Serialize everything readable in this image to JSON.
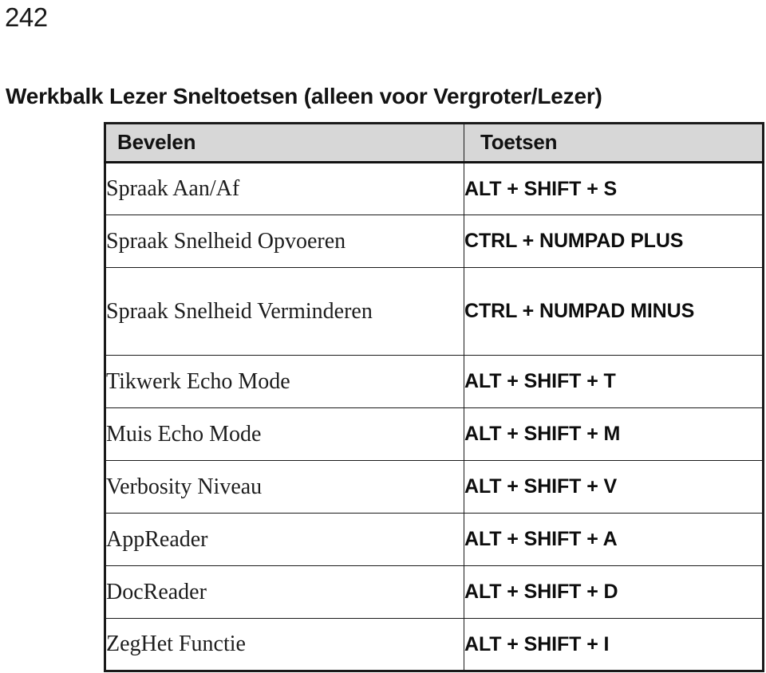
{
  "page": {
    "number": "242"
  },
  "heading": {
    "text": "Werkbalk Lezer Sneltoetsen (alleen voor Vergroter/Lezer)"
  },
  "table": {
    "columns": {
      "commands": "Bevelen",
      "keys": "Toetsen"
    },
    "rows": [
      {
        "command": "Spraak Aan/Af",
        "keys": "ALT + SHIFT + S"
      },
      {
        "command": "Spraak Snelheid Opvoeren",
        "keys": "CTRL + NUMPAD PLUS"
      },
      {
        "command": "Spraak Snelheid Verminderen",
        "keys": "CTRL + NUMPAD MINUS"
      },
      {
        "command": "Tikwerk Echo Mode",
        "keys": "ALT + SHIFT + T"
      },
      {
        "command": "Muis Echo Mode",
        "keys": "ALT + SHIFT + M"
      },
      {
        "command": "Verbosity Niveau",
        "keys": "ALT + SHIFT + V"
      },
      {
        "command": "AppReader",
        "keys": "ALT + SHIFT + A"
      },
      {
        "command": "DocReader",
        "keys": "ALT + SHIFT + D"
      },
      {
        "command": "ZegHet Functie",
        "keys": "ALT + SHIFT + I"
      }
    ]
  },
  "colors": {
    "header_background": "#d7d7d7",
    "border": "#1a1a1a",
    "text": "#111111",
    "page_background": "#ffffff"
  }
}
